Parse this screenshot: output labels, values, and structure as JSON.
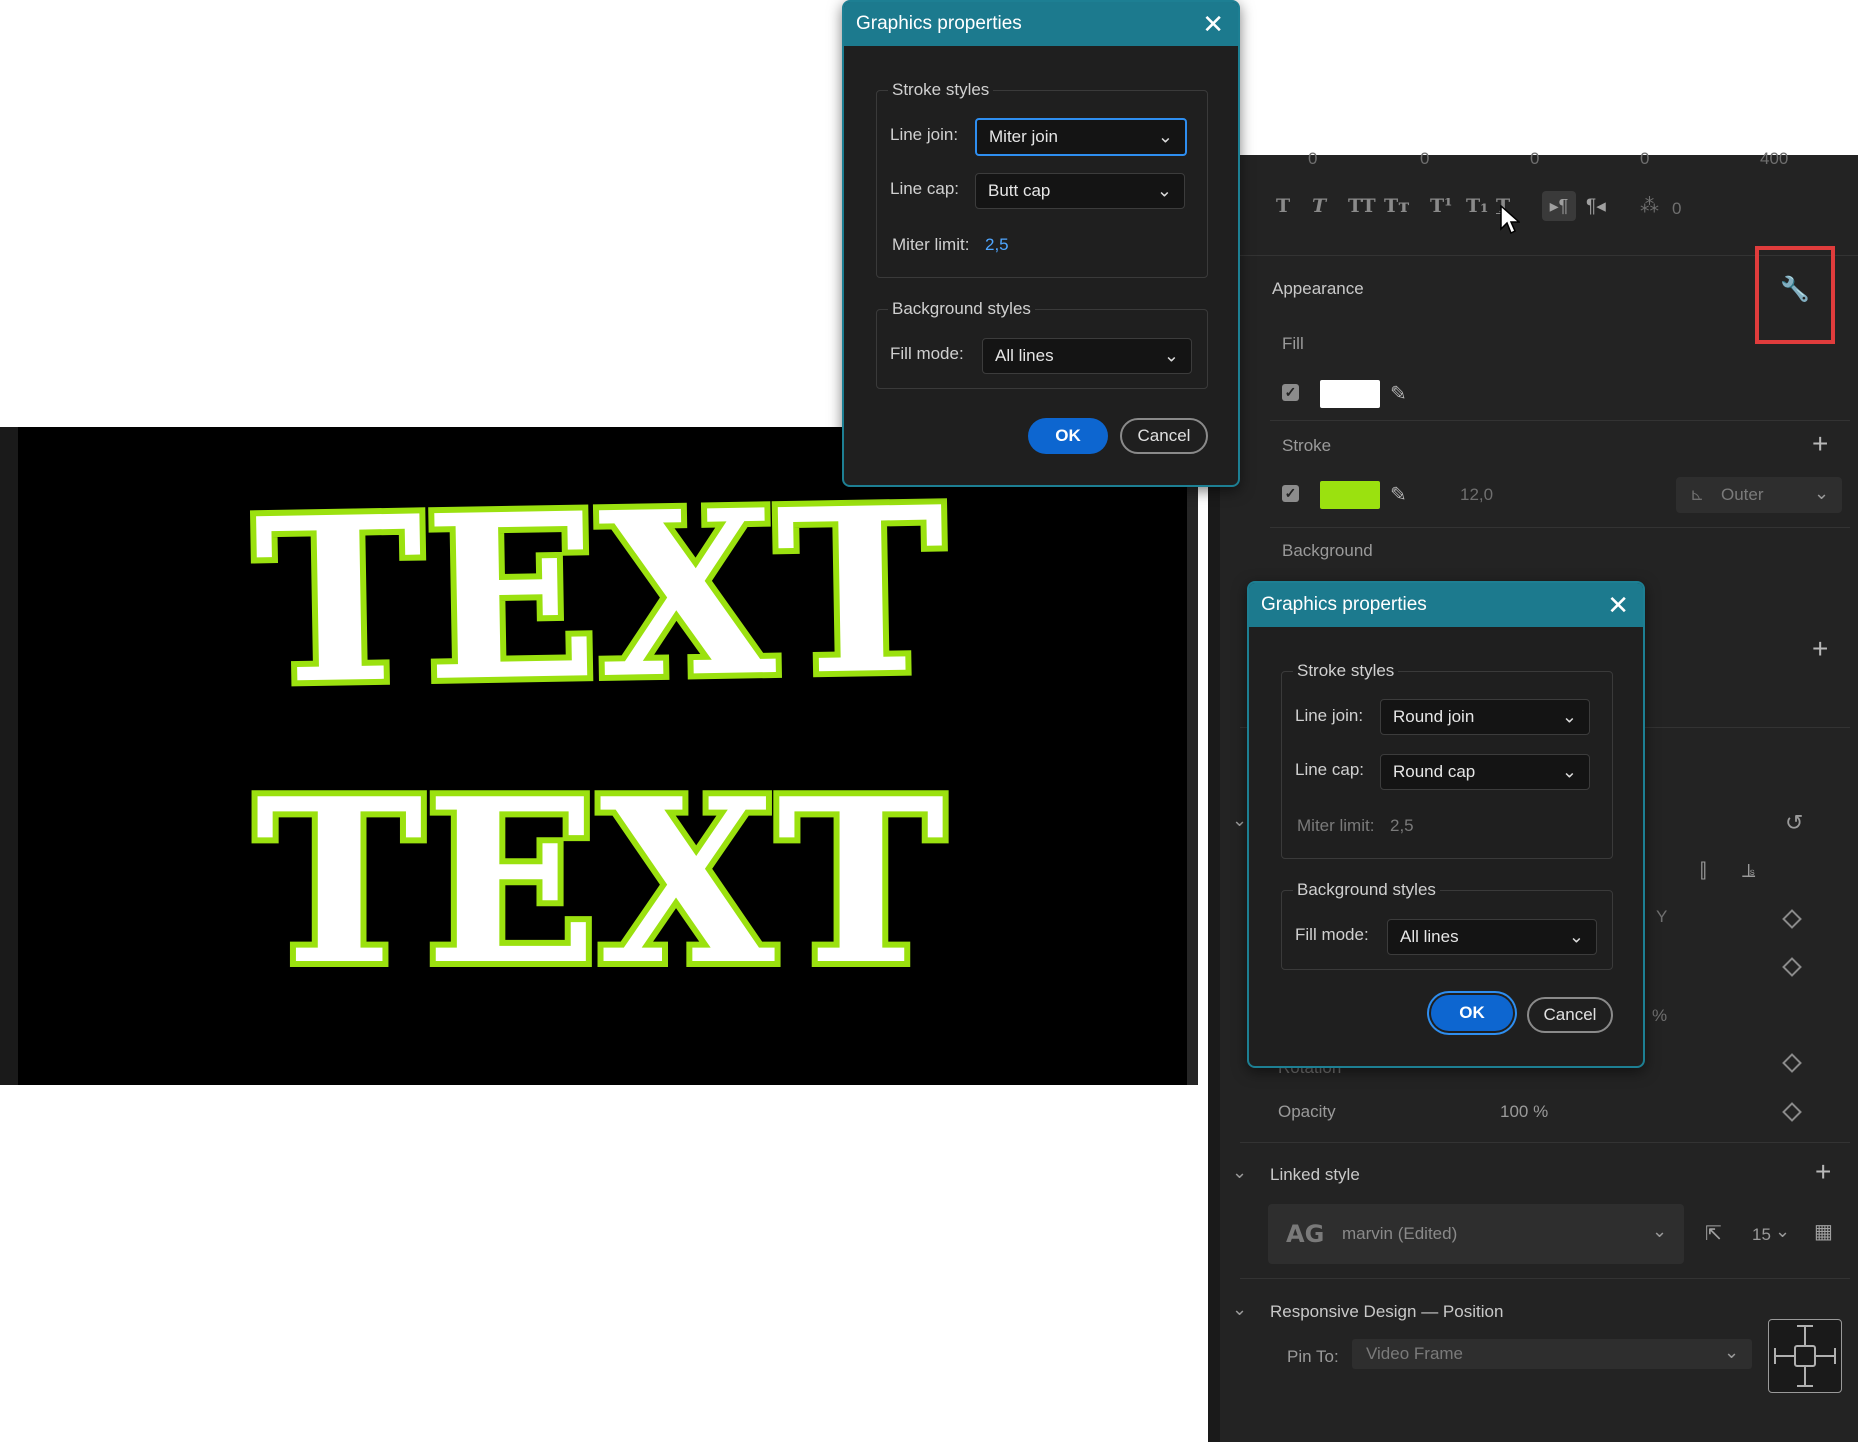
{
  "preview": {
    "line1": "TEXT",
    "line2": "TEXT",
    "fill_color": "#ffffff",
    "stroke_color": "#9be10f"
  },
  "panel": {
    "top_values": [
      "0",
      "0",
      "0",
      "0",
      "400"
    ],
    "tracking_value": "0",
    "appearance": {
      "header": "Appearance",
      "fill_label": "Fill",
      "fill_color": "#ffffff",
      "stroke_label": "Stroke",
      "stroke_color": "#9be10f",
      "stroke_width": "12,0",
      "stroke_position": "Outer",
      "background_label": "Background"
    },
    "opacity_label": "Opacity",
    "opacity_value": "100 %",
    "rotation_label": "Rotation",
    "y_label": "Y",
    "percent_fragment": "%",
    "linked_style": {
      "header": "Linked style",
      "style_icon": "AG",
      "style_name": "marvin (Edited)",
      "size_value": "15"
    },
    "responsive": {
      "header": "Responsive Design — Position",
      "pin_label": "Pin To:",
      "pin_value": "Video Frame"
    }
  },
  "dialog_top": {
    "title": "Graphics properties",
    "stroke_group": "Stroke styles",
    "line_join_label": "Line join:",
    "line_join_value": "Miter join",
    "line_cap_label": "Line cap:",
    "line_cap_value": "Butt cap",
    "miter_label": "Miter limit:",
    "miter_value": "2,5",
    "bg_group": "Background styles",
    "fill_mode_label": "Fill mode:",
    "fill_mode_value": "All lines",
    "ok": "OK",
    "cancel": "Cancel"
  },
  "dialog_bottom": {
    "title": "Graphics properties",
    "stroke_group": "Stroke styles",
    "line_join_label": "Line join:",
    "line_join_value": "Round join",
    "line_cap_label": "Line cap:",
    "line_cap_value": "Round cap",
    "miter_label": "Miter limit:",
    "miter_value": "2,5",
    "bg_group": "Background styles",
    "fill_mode_label": "Fill mode:",
    "fill_mode_value": "All lines",
    "ok": "OK",
    "cancel": "Cancel"
  },
  "highlight_color": "#e03c3c",
  "accent_color": "#0d66d0"
}
